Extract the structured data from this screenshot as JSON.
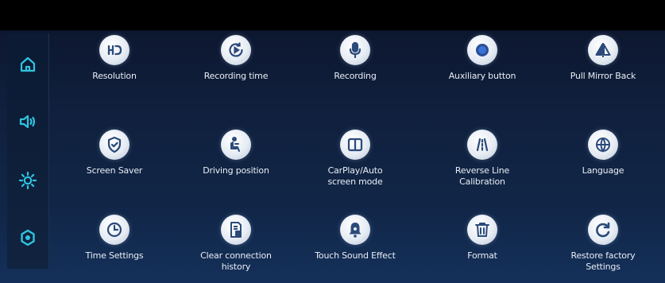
{
  "sidebar": {
    "items": [
      {
        "icon": "home-icon"
      },
      {
        "icon": "speaker-icon"
      },
      {
        "icon": "brightness-icon"
      },
      {
        "icon": "settings-icon"
      }
    ],
    "accent_color": "#2fc4e0"
  },
  "settings": {
    "items": [
      {
        "label": "Resolution",
        "icon": "hd-icon"
      },
      {
        "label": "Recording time",
        "icon": "recording-time-icon"
      },
      {
        "label": "Recording",
        "icon": "microphone-icon"
      },
      {
        "label": "Auxiliary button",
        "icon": "auxiliary-dot-icon"
      },
      {
        "label": "Pull Mirror Back",
        "icon": "mirror-icon"
      },
      {
        "label": "Screen Saver",
        "icon": "shield-icon"
      },
      {
        "label": "Driving position",
        "icon": "driver-seat-icon"
      },
      {
        "label": "CarPlay/Auto\nscreen mode",
        "icon": "split-screen-icon"
      },
      {
        "label": "Reverse Line\nCalibration",
        "icon": "reverse-lines-icon"
      },
      {
        "label": "Language",
        "icon": "globe-icon"
      },
      {
        "label": "Time Settings",
        "icon": "clock-icon"
      },
      {
        "label": "Clear connection\nhistory",
        "icon": "clear-history-icon"
      },
      {
        "label": "Touch Sound Effect",
        "icon": "bell-icon"
      },
      {
        "label": "Format",
        "icon": "trash-icon"
      },
      {
        "label": "Restore factory\nSettings",
        "icon": "restore-icon"
      }
    ],
    "icon_color": "#2b4a7a"
  }
}
